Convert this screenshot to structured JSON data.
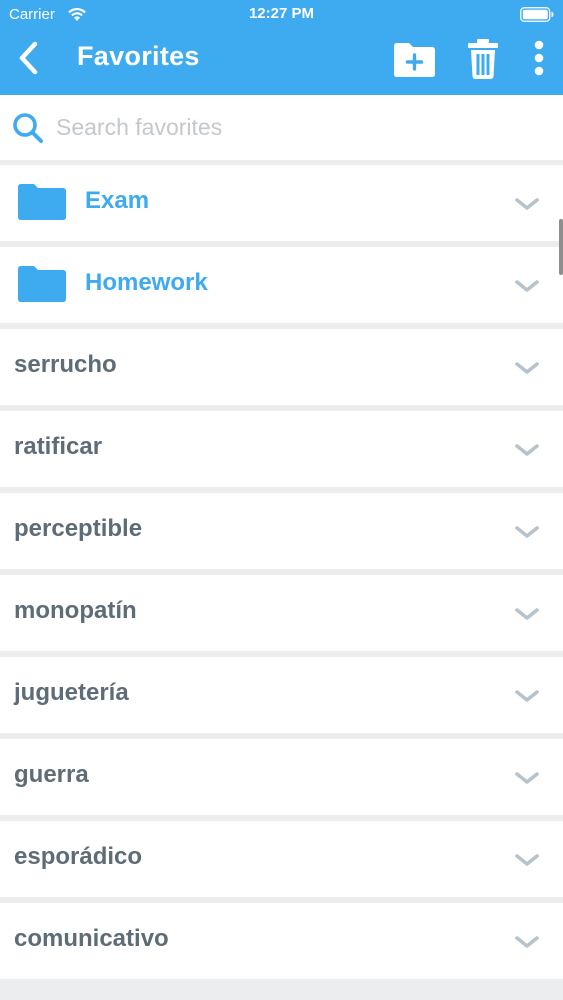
{
  "status_bar": {
    "carrier": "Carrier",
    "time": "12:27 PM"
  },
  "nav": {
    "title": "Favorites",
    "icons": [
      "chevron-left-icon",
      "new-folder-icon",
      "trash-icon",
      "more-vertical-icon"
    ]
  },
  "search": {
    "placeholder": "Search favorites",
    "value": ""
  },
  "folders": [
    {
      "label": "Exam"
    },
    {
      "label": "Homework"
    }
  ],
  "words": [
    {
      "label": "serrucho"
    },
    {
      "label": "ratificar"
    },
    {
      "label": "perceptible"
    },
    {
      "label": "monopatín"
    },
    {
      "label": "juguetería"
    },
    {
      "label": "guerra"
    },
    {
      "label": "esporádico"
    },
    {
      "label": "comunicativo"
    }
  ],
  "colors": {
    "header": "#3eaaf0",
    "folder_text": "#3eaaf0",
    "word_text": "#5e6c78",
    "chevron": "#b7c3cc",
    "background": "#ebedef",
    "search_icon": "#3eaaf0",
    "placeholder": "#c3c8cc"
  }
}
